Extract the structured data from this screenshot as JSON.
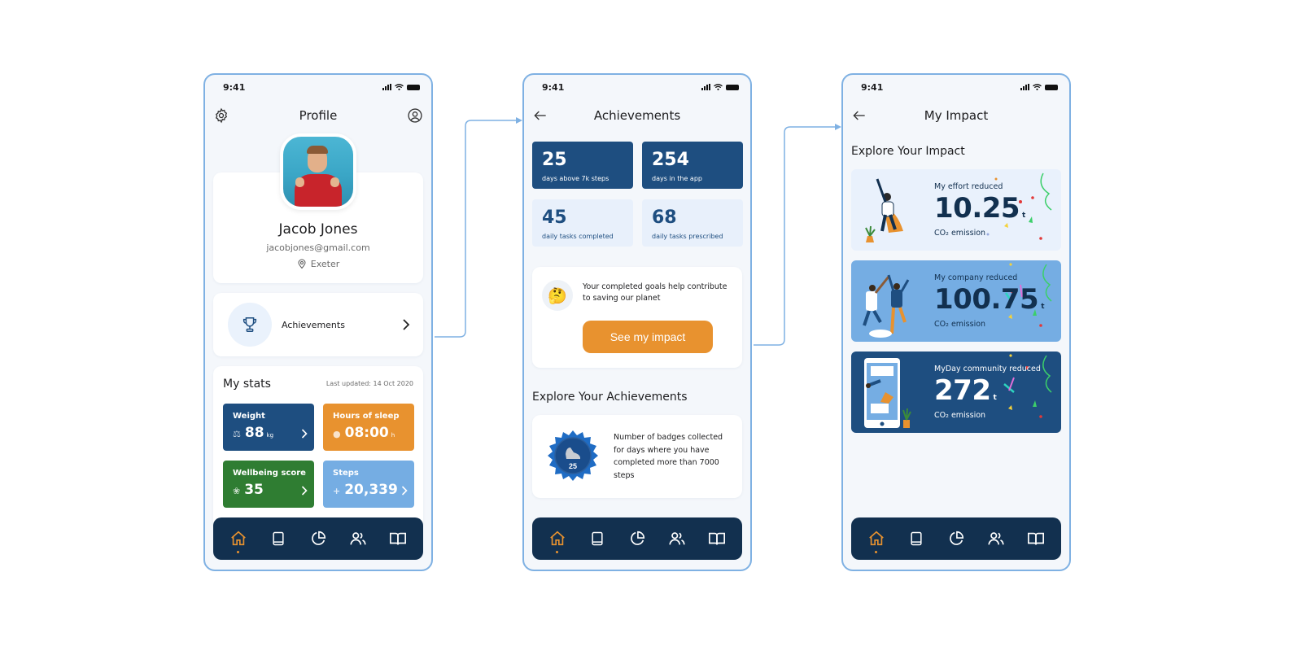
{
  "status_bar": {
    "time": "9:41"
  },
  "profile_screen": {
    "title": "Profile",
    "user": {
      "name": "Jacob Jones",
      "email": "jacobjones@gmail.com",
      "location": "Exeter"
    },
    "achievements_link": "Achievements",
    "stats": {
      "title": "My stats",
      "last_updated": "Last updated: 14 Oct 2020",
      "tiles": [
        {
          "label": "Weight",
          "value": "88",
          "unit": "kg",
          "icon": "weight-icon",
          "color": "#1e4e80"
        },
        {
          "label": "Hours of sleep",
          "value": "08:00",
          "unit": "h",
          "icon": "brain-icon",
          "color": "#e8922f"
        },
        {
          "label": "Wellbeing score",
          "value": "35",
          "unit": "",
          "icon": "lotus-icon",
          "color": "#2f7d32"
        },
        {
          "label": "Steps",
          "value": "20,339",
          "unit": "",
          "icon": "plus-icon",
          "color": "#75ade3"
        }
      ]
    }
  },
  "achievements_screen": {
    "title": "Achievements",
    "tiles": [
      {
        "value": "25",
        "label": "days above 7k steps"
      },
      {
        "value": "254",
        "label": "days in the app"
      },
      {
        "value": "45",
        "label": "daily tasks completed"
      },
      {
        "value": "68",
        "label": "daily tasks prescribed"
      }
    ],
    "impact_prompt": "Your completed goals help contribute to saving our planet",
    "impact_emoji": "🤔",
    "impact_button": "See my impact",
    "explore_title": "Explore Your Achievements",
    "badge": {
      "count": "25",
      "description": "Number of badges collected for days where you have completed more than 7000 steps"
    }
  },
  "impact_screen": {
    "title": "My Impact",
    "explore_title": "Explore Your Impact",
    "cards": [
      {
        "label": "My effort reduced",
        "value": "10.25",
        "unit": "t",
        "sub": "CO₂ emission"
      },
      {
        "label": "My company reduced",
        "value": "100.75",
        "unit": "t",
        "sub": "CO₂ emission"
      },
      {
        "label": "MyDay community reduced",
        "value": "272",
        "unit": "t",
        "sub": "CO₂ emission"
      }
    ]
  },
  "navbar": {
    "items": [
      "home-icon",
      "book-icon",
      "pie-chart-icon",
      "people-icon",
      "open-book-icon"
    ],
    "active_index": 0
  },
  "colors": {
    "accent": "#e8922f",
    "primary": "#1e4e80",
    "navbar": "#12304f",
    "frame_border": "#7fb1e3"
  }
}
